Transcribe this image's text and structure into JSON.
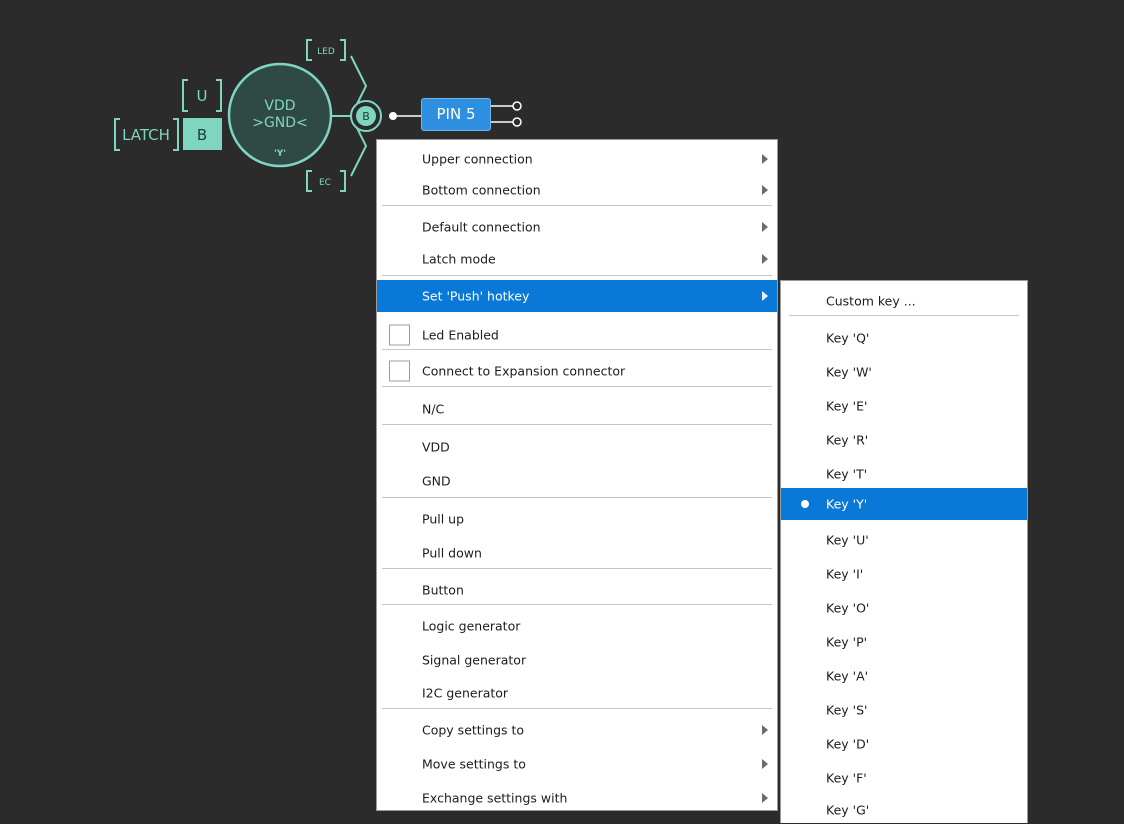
{
  "diagram": {
    "latch_label": "LATCH",
    "u_label": "U",
    "b_label": "B",
    "circle_line1": "VDD",
    "circle_line2": ">GND<",
    "circle_line3": "'Y'",
    "node_label": "B",
    "led_label": "LED",
    "ec_label": "EC",
    "pin_label": "PIN 5"
  },
  "context_menu": {
    "upper_connection": "Upper connection",
    "bottom_connection": "Bottom connection",
    "default_connection": "Default connection",
    "latch_mode": "Latch mode",
    "set_push_hotkey": "Set 'Push' hotkey",
    "led_enabled": "Led Enabled",
    "connect_expansion": "Connect to Expansion connector",
    "nc": "N/C",
    "vdd": "VDD",
    "gnd": "GND",
    "pull_up": "Pull up",
    "pull_down": "Pull down",
    "button": "Button",
    "logic_generator": "Logic generator",
    "signal_generator": "Signal generator",
    "i2c_generator": "I2C generator",
    "copy_settings": "Copy settings to",
    "move_settings": "Move settings to",
    "exchange_settings": "Exchange settings with"
  },
  "hotkey_submenu": {
    "custom_key": "Custom key ...",
    "selected": "Key 'Y'",
    "keys": [
      "Key 'Q'",
      "Key 'W'",
      "Key 'E'",
      "Key 'R'",
      "Key 'T'",
      "Key 'Y'",
      "Key 'U'",
      "Key 'I'",
      "Key 'O'",
      "Key 'P'",
      "Key 'A'",
      "Key 'S'",
      "Key 'D'",
      "Key 'F'",
      "Key 'G'"
    ]
  },
  "colors": {
    "background": "#2b2b2b",
    "accent_mint": "#7fd6c0",
    "pin_blue": "#2e8ee0",
    "highlight_blue": "#0a78d7"
  }
}
